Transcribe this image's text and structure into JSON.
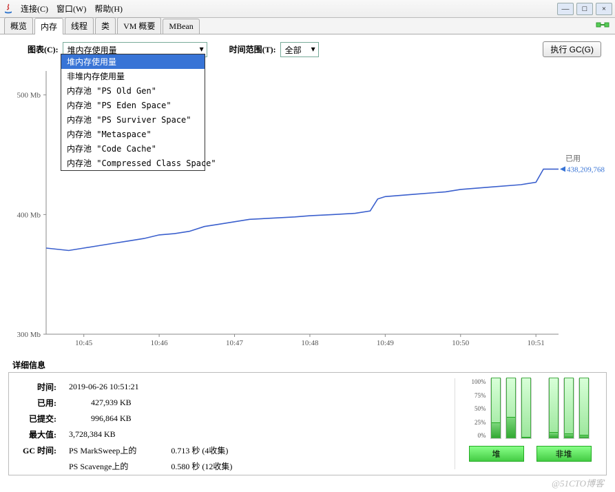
{
  "menu": {
    "connect": "连接(C)",
    "window": "窗口(W)",
    "help": "帮助(H)"
  },
  "winbtns": {
    "min": "—",
    "max": "□",
    "close": "×"
  },
  "tabs": [
    "概览",
    "内存",
    "线程",
    "类",
    "VM 概要",
    "MBean"
  ],
  "controls": {
    "chart_label": "图表(C):",
    "chart_value": "堆内存使用量",
    "time_label": "时间范围(T):",
    "time_value": "全部",
    "exec_gc": "执行 GC(G)"
  },
  "dropdown": {
    "selected": "堆内存使用量",
    "options": [
      "堆内存使用量",
      "非堆内存使用量",
      "内存池 \"PS Old Gen\"",
      "内存池 \"PS Eden Space\"",
      "内存池 \"PS Surviver Space\"",
      "内存池 \"Metaspace\"",
      "内存池 \"Code Cache\"",
      "内存池 \"Compressed Class Space\""
    ]
  },
  "chart_data": {
    "type": "line",
    "xlabel": "",
    "ylabel": "",
    "y_ticks": [
      300,
      400,
      500
    ],
    "y_unit": "Mb",
    "ylim": [
      300,
      520
    ],
    "x_categories": [
      "10:45",
      "10:46",
      "10:47",
      "10:48",
      "10:49",
      "10:50",
      "10:51"
    ],
    "series": [
      {
        "name": "已用",
        "color": "#3a5fcd",
        "points": [
          {
            "t": "10:44.5",
            "v": 372
          },
          {
            "t": "10:44.8",
            "v": 370
          },
          {
            "t": "10:45",
            "v": 372
          },
          {
            "t": "10:45.2",
            "v": 374
          },
          {
            "t": "10:45.4",
            "v": 376
          },
          {
            "t": "10:45.6",
            "v": 378
          },
          {
            "t": "10:45.8",
            "v": 380
          },
          {
            "t": "10:46",
            "v": 383
          },
          {
            "t": "10:46.2",
            "v": 384
          },
          {
            "t": "10:46.4",
            "v": 386
          },
          {
            "t": "10:46.6",
            "v": 390
          },
          {
            "t": "10:46.8",
            "v": 392
          },
          {
            "t": "10:47",
            "v": 394
          },
          {
            "t": "10:47.2",
            "v": 396
          },
          {
            "t": "10:47.5",
            "v": 397
          },
          {
            "t": "10:47.8",
            "v": 398
          },
          {
            "t": "10:48",
            "v": 399
          },
          {
            "t": "10:48.3",
            "v": 400
          },
          {
            "t": "10:48.6",
            "v": 401
          },
          {
            "t": "10:48.8",
            "v": 403
          },
          {
            "t": "10:48.9",
            "v": 413
          },
          {
            "t": "10:49",
            "v": 415
          },
          {
            "t": "10:49.4",
            "v": 417
          },
          {
            "t": "10:49.8",
            "v": 419
          },
          {
            "t": "10:50",
            "v": 421
          },
          {
            "t": "10:50.4",
            "v": 423
          },
          {
            "t": "10:50.8",
            "v": 425
          },
          {
            "t": "10:51",
            "v": 427
          },
          {
            "t": "10:51.1",
            "v": 438
          },
          {
            "t": "10:51.3",
            "v": 438
          }
        ]
      }
    ],
    "annotation": {
      "label": "已用",
      "value": "438,209,768",
      "at": "10:51.3",
      "v": 438
    }
  },
  "details": {
    "title": "详细信息",
    "rows": {
      "time_label": "时间:",
      "time_value": "2019-06-26 10:51:21",
      "used_label": "已用:",
      "used_value": "427,939 KB",
      "committed_label": "已提交:",
      "committed_value": "996,864 KB",
      "max_label": "最大值:",
      "max_value": "3,728,384 KB",
      "gc_label": "GC 时间:",
      "gc1_name": "PS MarkSweep上的",
      "gc1_val": "0.713 秒 (4收集)",
      "gc2_name": "PS Scavenge上的",
      "gc2_val": "0.580 秒 (12收集)"
    }
  },
  "bars": {
    "ticks": [
      "100%",
      "75%",
      "50%",
      "25%",
      "0%"
    ],
    "heap": {
      "label": "堆",
      "bars": [
        {
          "alloc": 88,
          "used": 22
        },
        {
          "alloc": 88,
          "used": 30
        },
        {
          "alloc": 88,
          "used": 0
        }
      ]
    },
    "nonheap": {
      "label": "非堆",
      "bars": [
        {
          "alloc": 88,
          "used": 8
        },
        {
          "alloc": 88,
          "used": 6
        },
        {
          "alloc": 88,
          "used": 4
        }
      ]
    }
  },
  "watermark": "@51CTO博客"
}
